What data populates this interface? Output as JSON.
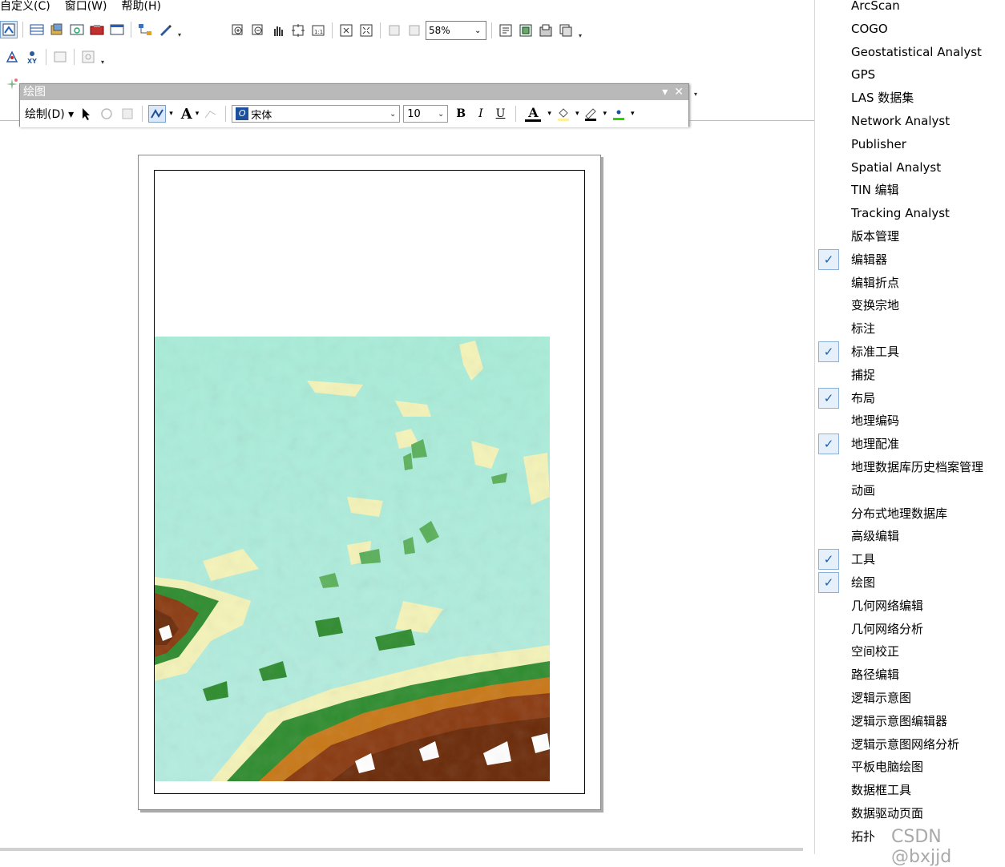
{
  "menu": [
    {
      "label": "自定义(C)"
    },
    {
      "label": "窗口(W)"
    },
    {
      "label": "帮助(H)"
    }
  ],
  "toolbar": {
    "zoom_value": "58%"
  },
  "drawing_toolbar": {
    "title": "绘图",
    "draw_menu_label": "绘制(D)",
    "font_name": "宋体",
    "font_size": "10",
    "bold_label": "B",
    "italic_label": "I",
    "underline_label": "U",
    "text_tool_label": "A",
    "font_color_label": "A"
  },
  "colors": {
    "accent_blue": "#1a5fa8",
    "check_bg": "#e6f0fb",
    "title_bar": "#b9b9b9",
    "dem_low": "#b0ecdc",
    "dem_mid": "#f4f3b8",
    "dem_green": "#2e8c2e",
    "dem_brown": "#8a3a10",
    "marker_fill": "#2ad400"
  },
  "toolbar_list": [
    {
      "label": "ArcScan",
      "checked": false
    },
    {
      "label": "COGO",
      "checked": false
    },
    {
      "label": "Geostatistical Analyst",
      "checked": false
    },
    {
      "label": "GPS",
      "checked": false
    },
    {
      "label": "LAS 数据集",
      "checked": false
    },
    {
      "label": "Network Analyst",
      "checked": false
    },
    {
      "label": "Publisher",
      "checked": false
    },
    {
      "label": "Spatial Analyst",
      "checked": false
    },
    {
      "label": "TIN 编辑",
      "checked": false
    },
    {
      "label": "Tracking Analyst",
      "checked": false
    },
    {
      "label": "版本管理",
      "checked": false
    },
    {
      "label": "编辑器",
      "checked": true
    },
    {
      "label": "编辑折点",
      "checked": false
    },
    {
      "label": "变换宗地",
      "checked": false
    },
    {
      "label": "标注",
      "checked": false
    },
    {
      "label": "标准工具",
      "checked": true
    },
    {
      "label": "捕捉",
      "checked": false
    },
    {
      "label": "布局",
      "checked": true
    },
    {
      "label": "地理编码",
      "checked": false
    },
    {
      "label": "地理配准",
      "checked": true
    },
    {
      "label": "地理数据库历史档案管理",
      "checked": false
    },
    {
      "label": "动画",
      "checked": false
    },
    {
      "label": "分布式地理数据库",
      "checked": false
    },
    {
      "label": "高级编辑",
      "checked": false
    },
    {
      "label": "工具",
      "checked": true
    },
    {
      "label": "绘图",
      "checked": true
    },
    {
      "label": "几何网络编辑",
      "checked": false
    },
    {
      "label": "几何网络分析",
      "checked": false
    },
    {
      "label": "空间校正",
      "checked": false
    },
    {
      "label": "路径编辑",
      "checked": false
    },
    {
      "label": "逻辑示意图",
      "checked": false
    },
    {
      "label": "逻辑示意图编辑器",
      "checked": false
    },
    {
      "label": "逻辑示意图网络分析",
      "checked": false
    },
    {
      "label": "平板电脑绘图",
      "checked": false
    },
    {
      "label": "数据框工具",
      "checked": false
    },
    {
      "label": "数据驱动页面",
      "checked": false
    },
    {
      "label": "拓扑",
      "checked": false
    }
  ],
  "watermark": "CSDN @bxjjd"
}
